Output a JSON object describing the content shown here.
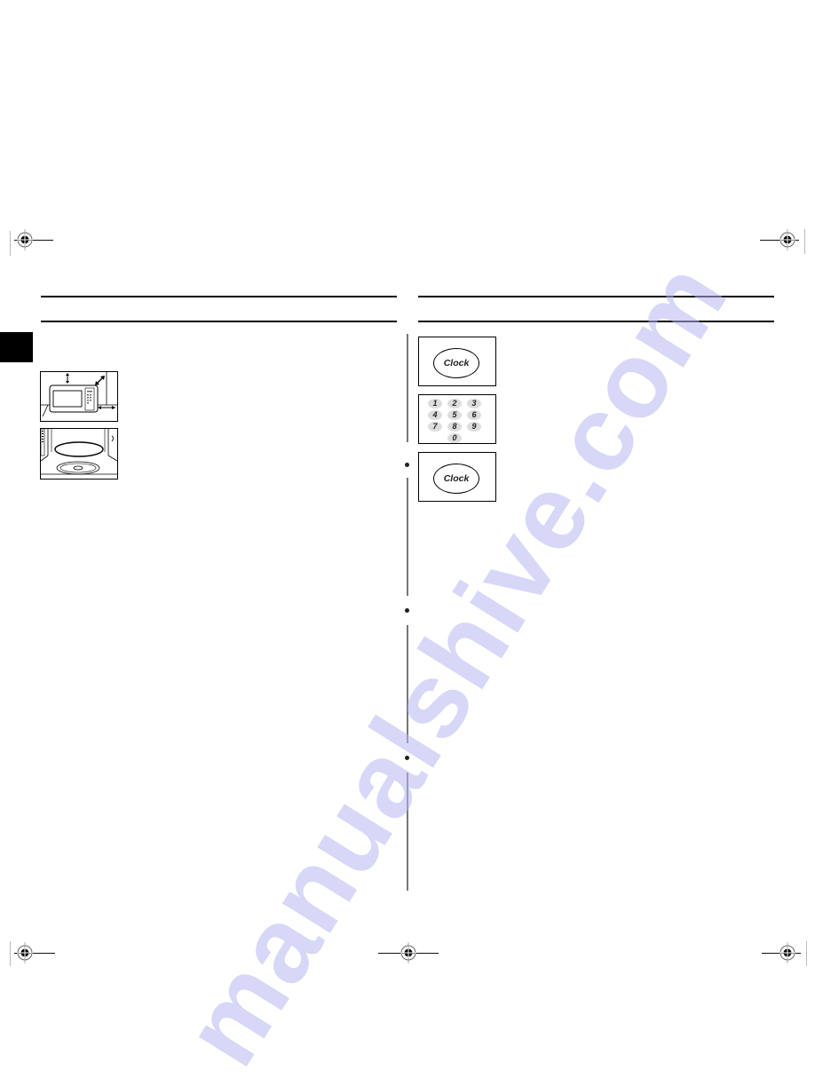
{
  "page": {
    "type": "scanned-manual-page",
    "language_tab_marker": "",
    "left_column": {
      "heading": "",
      "figures": [
        {
          "name": "microwave-installation-clearance",
          "description": "Microwave oven with clearance arrows"
        },
        {
          "name": "turntable-inside-oven",
          "description": "Turntable and roller ring inside oven cavity"
        }
      ]
    },
    "right_column": {
      "heading": "",
      "figures": [
        {
          "name": "clock-button-step-1",
          "button_label": "Clock"
        },
        {
          "name": "number-keypad-step-2",
          "keys": [
            "1",
            "2",
            "3",
            "4",
            "5",
            "6",
            "7",
            "8",
            "9",
            "0"
          ]
        },
        {
          "name": "clock-button-step-3",
          "button_label": "Clock"
        }
      ],
      "bullet_count": 3
    },
    "watermark": "manualshive.com"
  }
}
